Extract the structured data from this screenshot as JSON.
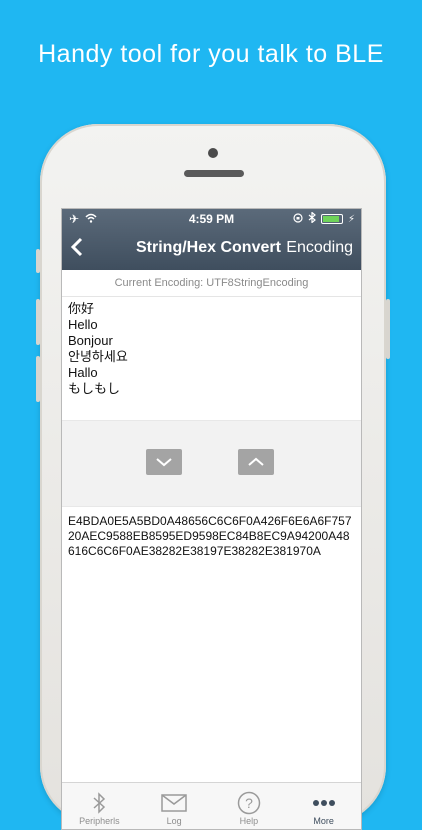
{
  "headline": "Handy tool for you talk to BLE",
  "status_bar": {
    "time": "4:59 PM"
  },
  "nav": {
    "back_label": "<",
    "title": "String/Hex Convert",
    "encoding_button": "Encoding"
  },
  "current_encoding": "Current Encoding: UTF8StringEncoding",
  "input_lines": [
    "你好",
    "Hello",
    "Bonjour",
    "안녕하세요",
    "Hallo",
    "もしもし"
  ],
  "hex_output": "E4BDA0E5A5BD0A48656C6C6F0A426F6E6A6F75720AEC9588EB8595ED9598EC84B8EC9A94200A48616C6C6F0AE38282E38197E38282E381970A",
  "tabs": [
    {
      "label": "Peripherls",
      "icon": "bluetooth-icon"
    },
    {
      "label": "Log",
      "icon": "mail-icon"
    },
    {
      "label": "Help",
      "icon": "help-icon"
    },
    {
      "label": "More",
      "icon": "more-icon"
    }
  ],
  "colors": {
    "background": "#1fb7f2",
    "navbar": "#4a5a6a",
    "button_gray": "#a4a4a4",
    "battery": "#6fd35a"
  }
}
